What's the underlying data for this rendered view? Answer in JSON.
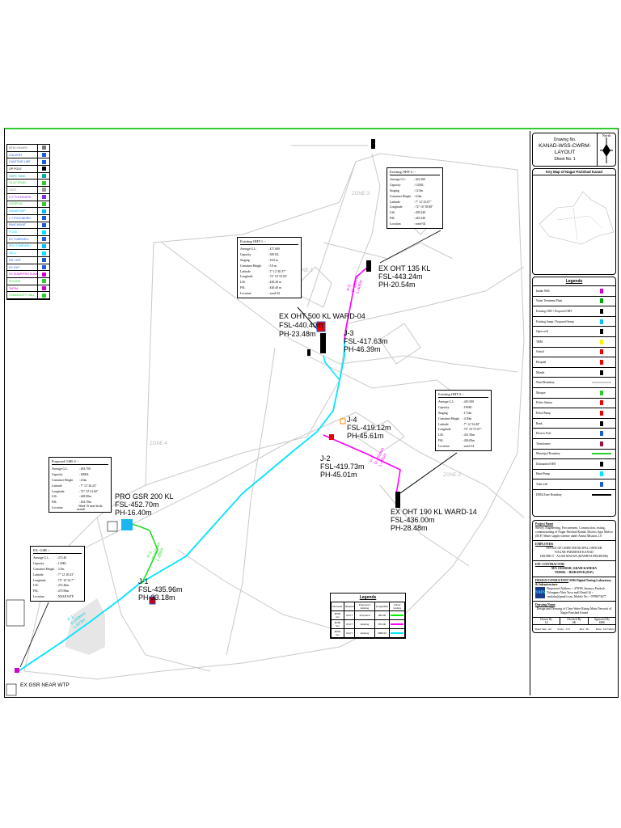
{
  "title_block": {
    "drawing_no_label": "Drawing No.",
    "drawing_no": "KANAD-WSS-CWRM-LAYOUT",
    "sheet": "Sheet No. 1",
    "north": "North",
    "key_map_title": "Key Map of Nagar Parishad Kanad"
  },
  "symbol_legend": [
    {
      "label": "BENCHMARK",
      "color": "#777"
    },
    {
      "label": "CULVERT",
      "color": "#1e5bd6"
    },
    {
      "label": "CANTOUR LINE",
      "color": "#1e5bd6"
    },
    {
      "label": "OP POLE",
      "color": "#000"
    },
    {
      "label": "HDPE TANK",
      "color": "#0aa"
    },
    {
      "label": "TILLE ROAD",
      "color": "#2ecc2e"
    },
    {
      "label": "GATE",
      "color": "#999"
    },
    {
      "label": "H.T POLE/BURN",
      "color": "#8a2be2"
    },
    {
      "label": "HOSPITAL",
      "color": "#2ecc2e"
    },
    {
      "label": "HANDPUMP",
      "color": "#00bfff"
    },
    {
      "label": "L.T POLE/BURN",
      "color": "#1e5bd6"
    },
    {
      "label": "PANCHAYAT",
      "color": "#1e5bd6"
    },
    {
      "label": "POND",
      "color": "#00e5ff"
    },
    {
      "label": "EX TUBEWELL",
      "color": "#1e5bd6"
    },
    {
      "label": "PRO TUBEWELL",
      "color": "#00bfff"
    },
    {
      "label": "WELL",
      "color": "#00e5ff"
    },
    {
      "label": "PM. OHT",
      "color": "#1e5bd6"
    },
    {
      "label": "EX OHT",
      "color": "#1e5bd6"
    },
    {
      "label": "EX SUMP/PRO SUMP",
      "color": "#d000d0"
    },
    {
      "label": "SCHOOL",
      "color": "#2ecc2e"
    },
    {
      "label": "TAPSA",
      "color": "#d000d0"
    },
    {
      "label": "COMMUNITY HALL",
      "color": "#2ecc2e"
    }
  ],
  "info_boxes": {
    "oht1": {
      "title": "Existing OHT-1 :-",
      "rows": [
        [
          "Average G.L.",
          ": 417.680"
        ],
        [
          "Capacity",
          ": 500 KL"
        ],
        [
          "Staging",
          ": 18.0 m"
        ],
        [
          "Container Height",
          ": 5.8 m"
        ],
        [
          "Latitude",
          ": 7° 12' 40.37\""
        ],
        [
          "Longitude",
          ": 72° 10' 53.02\""
        ],
        [
          "LSL",
          ": 438.40 m"
        ],
        [
          "FSL",
          ": 440.40 m"
        ],
        [
          "Location",
          ": ward 04"
        ]
      ]
    },
    "oht2": {
      "title": "Existing OHT-2 :-",
      "rows": [
        [
          "Average G.L.",
          ": 422.560"
        ],
        [
          "Capacity",
          ": 135KL"
        ],
        [
          "Staging",
          ": 12.0m"
        ],
        [
          "Container Height",
          ": 6.0m"
        ],
        [
          "Latitude",
          ": 7° 12' 43.07\""
        ],
        [
          "Longitude",
          ": 72° 10' 58.88\""
        ],
        [
          "LSL",
          ": 439.240"
        ],
        [
          "FSL",
          ": 443.240"
        ],
        [
          "Location",
          ": ward-02"
        ]
      ]
    },
    "oht3": {
      "title": "Existing OHT-3 :-",
      "rows": [
        [
          "Average G.L.",
          ": 410.500"
        ],
        [
          "Capacity",
          ": 190KL"
        ],
        [
          "Staging",
          ": 17.0m"
        ],
        [
          "Container Height",
          ": 4.50m"
        ],
        [
          "Latitude",
          ": 7° 12' 32.48\""
        ],
        [
          "Longitude",
          ": 72° 10' 57.67\""
        ],
        [
          "LSL",
          ": 431.50m"
        ],
        [
          "FSL",
          ": 436.00m"
        ],
        [
          "Location",
          ": ward-14"
        ]
      ]
    },
    "gsr4": {
      "title": "Proposed GSR-4 :-",
      "rows": [
        [
          "Average G.L.",
          ": 463.700"
        ],
        [
          "Capacity",
          ": 200KL"
        ],
        [
          "Container Height",
          ": 4.0m"
        ],
        [
          "Latitude",
          ": 7° 12' 26.24\""
        ],
        [
          "Longitude",
          ": 72° 10' 41.60\""
        ],
        [
          "LSL",
          ": 448.90m"
        ],
        [
          "FSL",
          ": 452.70m"
        ],
        [
          "Location",
          ": Ward 15 near kirila mandi"
        ]
      ]
    },
    "exgsr": {
      "title": "EX- GSR :-",
      "rows": [
        [
          "Average G.L.",
          ": 472.40"
        ],
        [
          "Capacity",
          ": 125KL"
        ],
        [
          "Container Height",
          ": 3.5m"
        ],
        [
          "Latitude",
          ": 7° 12' 20.43\""
        ],
        [
          "Longitude",
          ": 72° 10' 33.7\""
        ],
        [
          "LSL",
          ": 472.40m"
        ],
        [
          "FSL",
          ": 475.90m"
        ],
        [
          "Location",
          ": NEAR WTP"
        ]
      ]
    }
  },
  "map_labels": {
    "oht135": [
      "EX OHT 135 KL",
      "FSL-443.24m",
      "PH-20.54m"
    ],
    "oht500": [
      "EX OHT 500 KL WARD-04",
      "FSL-440.40m",
      "PH-23.48m"
    ],
    "j3": [
      "J-3",
      "FSL-417.63m",
      "PH-46.39m"
    ],
    "j4": [
      "J-4",
      "FSL-419.12m",
      "PH-45.61m"
    ],
    "j2": [
      "J-2",
      "FSL-419.73m",
      "PH-45.01m"
    ],
    "oht190": [
      "EX OHT 190 KL WARD-14",
      "FSL-436.00m",
      "PH-28.48m"
    ],
    "gsr200": [
      "PRO GSR 200 KL",
      "FSL-452.70m",
      "PH-16.40m"
    ],
    "j1": [
      "J-1",
      "FSL-435.96m",
      "PH-33.18m"
    ],
    "wtp": "EX GSR NEAR WTP",
    "zones": [
      "ZONE-1",
      "ZONE-2",
      "ZONE-3",
      "ZONE-4"
    ],
    "pipes": {
      "p1": [
        "P-1",
        "D-200mm",
        "L-973m"
      ],
      "p5": [
        "P-5",
        "D-150mm",
        "L-406m"
      ],
      "p7": [
        "P-7",
        "D-150mm",
        "L-491m"
      ],
      "p2": [
        "P-2",
        "D-150mm",
        "L-285m"
      ]
    }
  },
  "pipe_legend": {
    "title": "Legends",
    "headers": [
      "Diameter",
      "Material",
      "Proposed / Existing",
      "Length(Mtr)",
      "Colour Coding"
    ],
    "rows": [
      {
        "d": "Ø150 mm",
        "m": "DI-K7",
        "s": "Proposed",
        "l": "285.00",
        "color": "#00ee00"
      },
      {
        "d": "Ø150 mm",
        "m": "DI-K7",
        "s": "Existing",
        "l": "872.00",
        "color": "#ff00ff"
      },
      {
        "d": "Ø200 mm",
        "m": "DI-K7",
        "s": "Existing",
        "l": "2980.00",
        "color": "#00e5ff"
      }
    ]
  },
  "right_legend": {
    "title": "Legends",
    "items": [
      {
        "label": "Intake Well",
        "color": "#d000d0"
      },
      {
        "label": "Water Treatment Plant",
        "color": "#0a0"
      },
      {
        "label": "Existing OHT / Proposed OHT",
        "color": "#000"
      },
      {
        "label": "Existing Sump / Proposed Sump",
        "color": "#00bfff"
      },
      {
        "label": "Open well",
        "color": "#000"
      },
      {
        "label": "TBM",
        "color": "#ffee00"
      },
      {
        "label": "School",
        "color": "#e00"
      },
      {
        "label": "Hospital",
        "color": "#e00"
      },
      {
        "label": "Mandir",
        "color": "#000"
      },
      {
        "label": "Ward Boundary",
        "color": "#ccc"
      },
      {
        "label": "Mosque",
        "color": "#2ecc2e"
      },
      {
        "label": "Police Station",
        "color": "#e00"
      },
      {
        "label": "Petrol Pump",
        "color": "#e00"
      },
      {
        "label": "Bank",
        "color": "#000"
      },
      {
        "label": "Electric Pole",
        "color": "#1e5bd6"
      },
      {
        "label": "Transformer",
        "color": "#a01040"
      },
      {
        "label": "Municipal Boundary",
        "color": "#2ecc2e"
      },
      {
        "label": "Dismantled OHT",
        "color": "#000"
      },
      {
        "label": "Hand Pump",
        "color": "#00e5ff"
      },
      {
        "label": "Tube well",
        "color": "#1e5bd6"
      },
      {
        "label": "DMA/Zone Boundary",
        "color": "#000"
      }
    ]
  },
  "project": {
    "name_label": "Project Name",
    "name": "Survey, Engineering, Procurement, Construction, testing, commissioning of Nagar Parishad Kanad, District Agar Malwa (M.P.) Water supply scheme under Amrut Mission 2.0",
    "employer_label": "EMPLOYER",
    "employer": [
      "OFFICE OF CHIEF MUNICIPAL OFFICER",
      "NAGAR PARISHAD KANAD",
      "DISTRICT - AGAR MALWA (MADHYA PRADESH)"
    ],
    "contractor_label": "EPC CONTRACTOR",
    "contractor": [
      "M/S JAGDISH, GRAM KANERA",
      "TEHSIL - JEERAPUR (M.P.)"
    ],
    "design_label": "DESIGN CONSULTANT",
    "design_name": "SMS Digital Testing Laboratory & Infrastructure",
    "design_addr": "Registered Address :- 478/90, Saumya Pradesh Telangana Near Yuva mall Email Id :- smslabs@gmail.com, Mobile No.:- 0789673677",
    "logo": "SMS",
    "drawing_title_label": "Drawing Name",
    "drawing_title": "Design and Drawing of Clear Water Rising Main Network of Nagar Parishad Kanad",
    "drawn_by_label": "Drawn By",
    "drawn_by": "LS",
    "checked_by_label": "Checked By",
    "checked_by": "SK",
    "approved_by_label": "Approved By",
    "approved_by": "SMS",
    "sheet_size": "Sheet Size : A3",
    "scale": "Scale : 1:15",
    "rev": "Rev : R1",
    "date": "Date : 16/7/2024"
  }
}
